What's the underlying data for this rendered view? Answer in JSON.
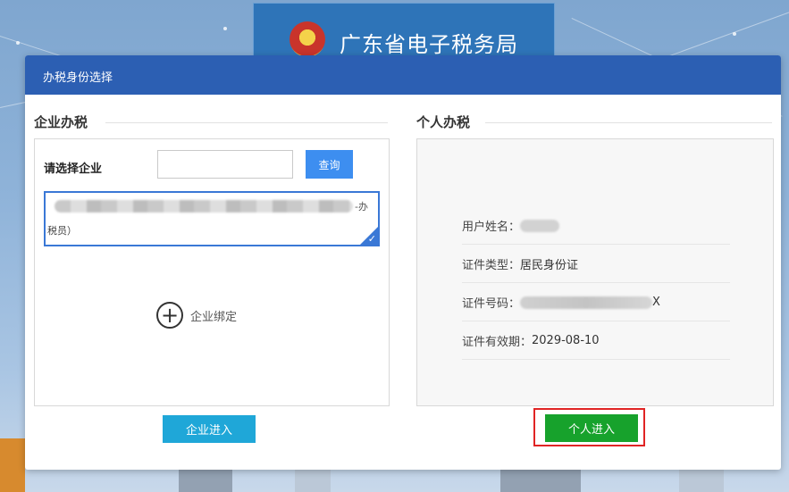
{
  "banner": {
    "title": "广东省电子税务局"
  },
  "dialog": {
    "title": "办税身份选择",
    "header_color": "#2c5fb3"
  },
  "company_section": {
    "title": "企业办税",
    "select_label": "请选择企业",
    "search_input_value": "",
    "query_button": "查询",
    "selected_item_suffix": "-办",
    "selected_item_line2": "税员）",
    "bind_label": "企业绑定",
    "enter_button": "企业进入"
  },
  "personal_section": {
    "title": "个人办税",
    "rows": [
      {
        "label": "用户姓名：",
        "value": ""
      },
      {
        "label": "证件类型：",
        "value": "居民身份证"
      },
      {
        "label": "证件号码：",
        "value": "X"
      },
      {
        "label": "证件有效期：",
        "value": "2029-08-10"
      }
    ],
    "enter_button": "个人进入"
  },
  "colors": {
    "query_button": "#3d8ef0",
    "company_enter": "#1fa7d8",
    "personal_enter": "#17a22c",
    "highlight": "#e02424"
  },
  "icons": {
    "bind": "plus-circle-icon",
    "selected": "check-icon",
    "emblem": "national-emblem-icon"
  }
}
